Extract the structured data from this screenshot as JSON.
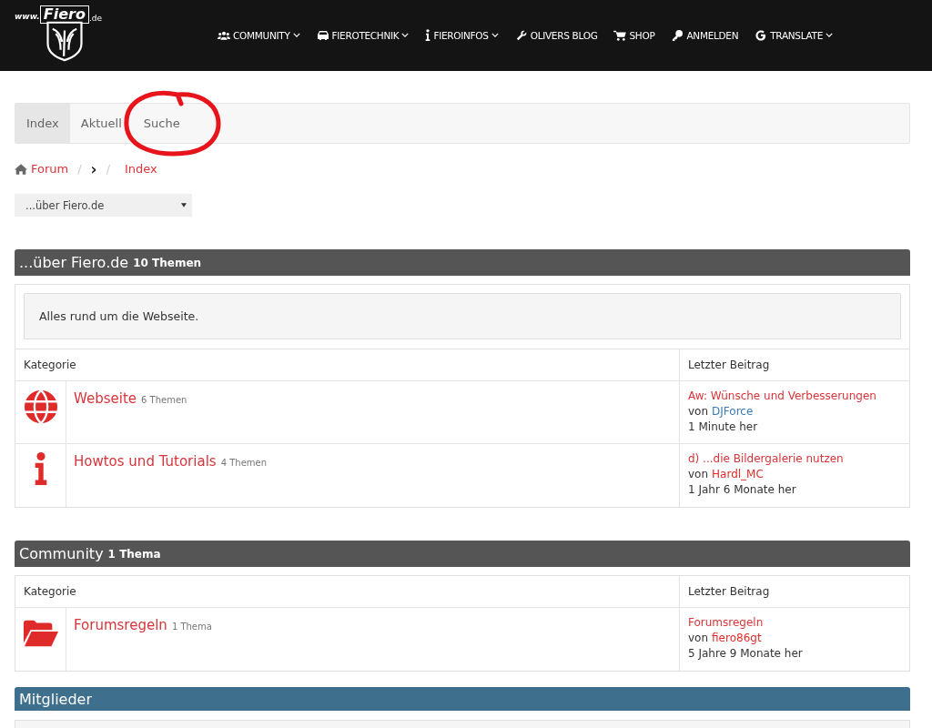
{
  "logo": {
    "prefix": "www.",
    "name": "Fiero",
    "suffix": ".de"
  },
  "nav": [
    {
      "label": "COMMUNITY",
      "kind": "users",
      "dropdown": true
    },
    {
      "label": "FIEROTECHNIK",
      "kind": "car",
      "dropdown": true
    },
    {
      "label": "FIEROINFOS",
      "kind": "info",
      "dropdown": true
    },
    {
      "label": "OLIVERS BLOG",
      "kind": "wrench",
      "dropdown": false
    },
    {
      "label": "SHOP",
      "kind": "cart",
      "dropdown": false
    },
    {
      "label": "ANMELDEN",
      "kind": "key",
      "dropdown": false
    },
    {
      "label": "TRANSLATE",
      "kind": "google",
      "dropdown": true
    }
  ],
  "tabs": [
    {
      "label": "Index",
      "selected": true
    },
    {
      "label": "Aktuell",
      "selected": false
    },
    {
      "label": "Suche",
      "selected": false
    }
  ],
  "breadcrumb": {
    "home": "Forum",
    "separator": "/",
    "chevron": "›",
    "current": "Index"
  },
  "jump_select": {
    "value": "...über Fiero.de"
  },
  "sections": [
    {
      "title": "...über Fiero.de",
      "count": "10 Themen",
      "kind": "category",
      "description": "Alles rund um die Webseite.",
      "columns": [
        "Kategorie",
        "Letzter Beitrag"
      ],
      "forums": [
        {
          "kind": "globe",
          "name": "Webseite",
          "count": "6 Themen",
          "last_title": "Aw: Wünsche und Verbesserungen",
          "by": "von",
          "author": "DJForce",
          "color": "#3a7bb5",
          "time": "1 Minute her"
        },
        {
          "kind": "info",
          "name": "Howtos und Tutorials",
          "count": "4 Themen",
          "last_title": "d) ...die Bildergalerie nutzen",
          "by": "von",
          "author": "Hardl_MC",
          "color": "#e02b2b",
          "time": "1 Jahr 6 Monate her"
        }
      ]
    },
    {
      "title": "Community",
      "count": "1 Thema",
      "kind": "category",
      "columns": [
        "Kategorie",
        "Letzter Beitrag"
      ],
      "forums": [
        {
          "kind": "folder",
          "name": "Forumsregeln",
          "count": "1 Thema",
          "last_title": "Forumsregeln",
          "by": "von",
          "author": "fiero86gt",
          "color": "#e02b2b",
          "time": "5 Jahre 9 Monate her"
        }
      ]
    },
    {
      "title": "Mitglieder",
      "kind": "members"
    }
  ]
}
